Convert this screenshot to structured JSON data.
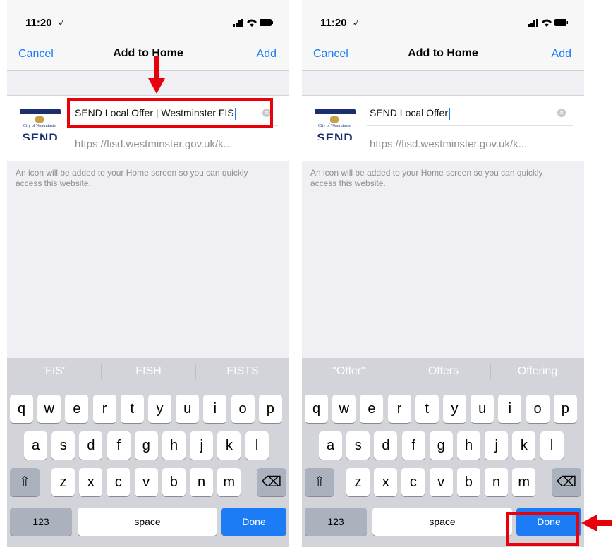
{
  "screens": [
    {
      "status": {
        "time": "11:20"
      },
      "nav": {
        "cancel": "Cancel",
        "title": "Add to Home",
        "add": "Add"
      },
      "icon_text": {
        "caption": "City of Westminster",
        "send": "SEND"
      },
      "name_value": "SEND Local Offer | Westminster FIS",
      "url": "https://fisd.westminster.gov.uk/k...",
      "hint": "An icon will be added to your Home screen so you can quickly access this website.",
      "suggestions": [
        "\"FIS\"",
        "FISH",
        "FISTS"
      ]
    },
    {
      "status": {
        "time": "11:20"
      },
      "nav": {
        "cancel": "Cancel",
        "title": "Add to Home",
        "add": "Add"
      },
      "icon_text": {
        "caption": "City of Westminster",
        "send": "SEND"
      },
      "name_value": "SEND Local Offer",
      "url": "https://fisd.westminster.gov.uk/k...",
      "hint": "An icon will be added to your Home screen so you can quickly access this website.",
      "suggestions": [
        "\"Offer\"",
        "Offers",
        "Offering"
      ]
    }
  ],
  "keyboard": {
    "row1": [
      "q",
      "w",
      "e",
      "r",
      "t",
      "y",
      "u",
      "i",
      "o",
      "p"
    ],
    "row2": [
      "a",
      "s",
      "d",
      "f",
      "g",
      "h",
      "j",
      "k",
      "l"
    ],
    "row3": [
      "z",
      "x",
      "c",
      "v",
      "b",
      "n",
      "m"
    ],
    "numbers": "123",
    "space": "space",
    "done": "Done",
    "shift_glyph": "⇧",
    "delete_glyph": "⌫"
  },
  "colors": {
    "ios_blue": "#1b7cf5",
    "highlight_red": "#e8000b"
  },
  "annotations": [
    "red-box-name-field",
    "red-arrow-down-to-name-field",
    "red-box-done-key",
    "red-arrow-left-to-done-key"
  ]
}
